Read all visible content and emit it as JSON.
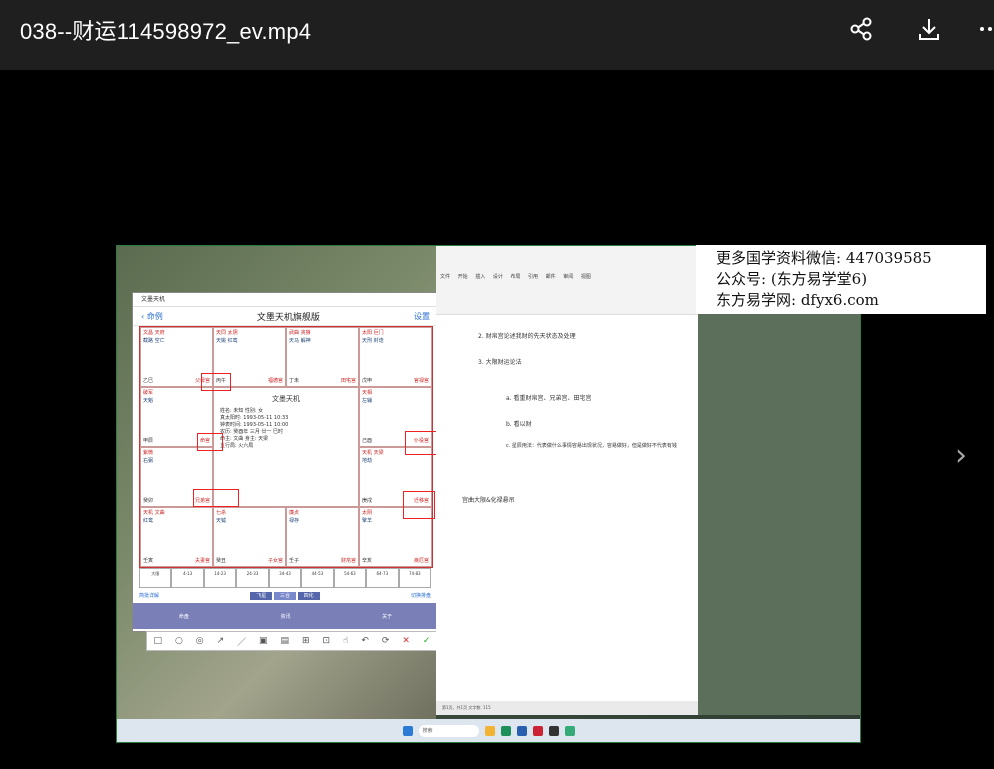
{
  "header": {
    "title": "038--财运114598972_ev.mp4",
    "actions": [
      {
        "icon": "share-icon"
      },
      {
        "icon": "download-icon"
      },
      {
        "icon": "more-icon"
      }
    ]
  },
  "video": {
    "app": {
      "window_title": "文墨天机",
      "back_label": "命例",
      "heading": "文墨天机旗舰版",
      "settings_label": "设置",
      "center_title": "文墨天机",
      "center_lines": [
        "姓名: 未知  性别: 女",
        "真太阳时: 1993-05-11 10:33",
        "钟表时间: 1993-05-11 10:00",
        "农历: 癸酉年 三月 廿一 巳时",
        "命主: 文曲  身主: 天梁",
        "五行局: 火六局"
      ],
      "palaces": [
        {
          "stars": "文昌 天府",
          "stars2": "截路 空亡",
          "stem": "乙巳",
          "name": "父母宫"
        },
        {
          "stars": "天同 太阴",
          "stars2": "天姚 红鸾",
          "stem": "丙午",
          "name": "福德宫"
        },
        {
          "stars": "武曲 贪狼",
          "stars2": "天马 解神",
          "stem": "丁未",
          "name": "田宅宫"
        },
        {
          "stars": "太阳 巨门",
          "stars2": "天刑 封诰",
          "stem": "戊申",
          "name": "官禄宫"
        },
        {
          "stars": "破军",
          "stars2": "天魁",
          "stem": "甲辰",
          "name": "命宫"
        },
        {
          "stars": "天相",
          "stars2": "左辅",
          "stem": "己酉",
          "name": "仆役宫"
        },
        {
          "stars": "紫微",
          "stars2": "右弼",
          "stem": "癸卯",
          "name": "兄弟宫"
        },
        {
          "stars": "天机 天梁",
          "stars2": "地劫",
          "stem": "庚戌",
          "name": "迁移宫"
        },
        {
          "stars": "天机 文曲",
          "stars2": "红鸾",
          "stem": "壬寅",
          "name": "夫妻宫"
        },
        {
          "stars": "七杀",
          "stars2": "天钺",
          "stem": "癸丑",
          "name": "子女宫"
        },
        {
          "stars": "廉贞",
          "stars2": "禄存",
          "stem": "壬子",
          "name": "财帛宫"
        },
        {
          "stars": "太阴",
          "stars2": "擎羊",
          "stem": "辛亥",
          "name": "疾厄宫"
        }
      ],
      "decades": [
        "大限",
        "4-13",
        "14-23",
        "24-33",
        "34-43",
        "44-53",
        "54-63",
        "64-73",
        "74-83"
      ],
      "modes": [
        "飞星",
        "三合",
        "四化"
      ],
      "left_link": "简批详解",
      "right_link": "切换排盘",
      "tabs": [
        "命盘",
        "资讯",
        "关于"
      ]
    },
    "draw_tools": [
      "□",
      "○",
      "◎",
      "↗",
      "／",
      "▣",
      "▤",
      "⊞",
      "⊡",
      "☝",
      "↶",
      "⟳",
      "✕",
      "✓"
    ],
    "doc": {
      "ribbon_tabs": [
        "文件",
        "开始",
        "插入",
        "设计",
        "布局",
        "引用",
        "邮件",
        "审阅",
        "视图"
      ],
      "lines": [
        "2.  财帛宫论述我财的先天状态及处理",
        "3.  大限财运论法",
        "a.  看重财帛宫、兄弟宫、田宅宫",
        "b.  看以财",
        "c.  星辰用法：代表做什么事情容易出现状况，容易做好，但是做好不代表有钱",
        "宫曲大限&化禄悬吊"
      ],
      "status": "第1页，共1页    文字数: 115"
    },
    "watermark": [
      "更多国学资料微信: 447039585",
      "公众号: (东方易学堂6)",
      "东方易学网: dfyx6.com"
    ],
    "taskbar_search": "搜索"
  }
}
